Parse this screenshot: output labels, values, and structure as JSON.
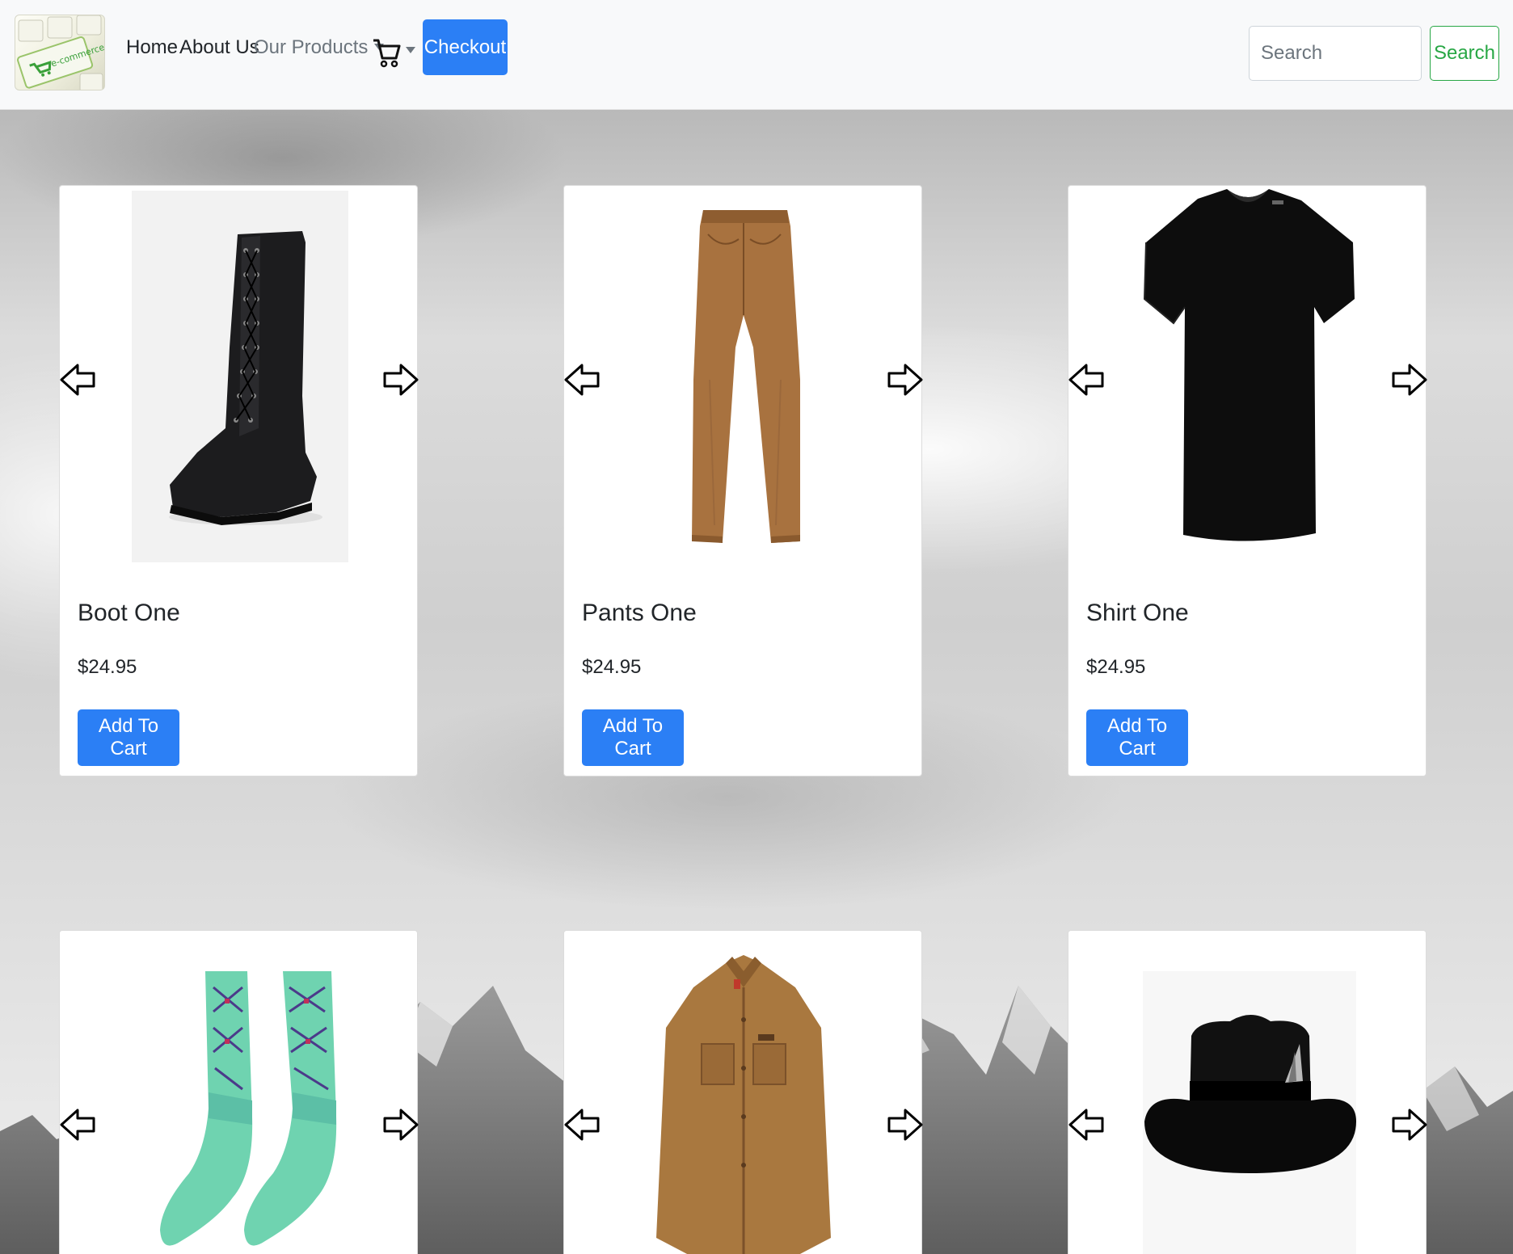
{
  "navbar": {
    "logo_text": "e-commerce",
    "links": {
      "home": "Home",
      "about": "About Us",
      "products": "Our Products"
    },
    "cart_icon": "shopping-cart-icon",
    "checkout_label": "Checkout",
    "search": {
      "placeholder": "Search",
      "button_label": "Search"
    }
  },
  "colors": {
    "primary": "#2b7ff5",
    "success": "#28a745",
    "navbar_bg": "#f8f9fa"
  },
  "products": [
    {
      "title": "Boot One",
      "price": "$24.95",
      "button": "Add To Cart",
      "image": "black-lace-up-boot"
    },
    {
      "title": "Pants One",
      "price": "$24.95",
      "button": "Add To Cart",
      "image": "tan-pants"
    },
    {
      "title": "Shirt One",
      "price": "$24.95",
      "button": "Add To Cart",
      "image": "black-t-shirt"
    },
    {
      "image": "teal-patterned-socks"
    },
    {
      "image": "tan-jacket"
    },
    {
      "image": "black-fedora-hat"
    }
  ],
  "icons": {
    "prev": "arrow-left-icon",
    "next": "arrow-right-icon"
  }
}
